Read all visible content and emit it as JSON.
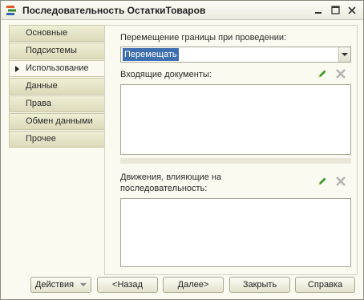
{
  "window": {
    "title": "Последовательность ОстаткиТоваров",
    "app_icon": "sequence-icon",
    "controls": [
      "minimize-icon",
      "maximize-icon",
      "close-icon"
    ]
  },
  "sidebar": {
    "active_index": 2,
    "items": [
      {
        "label": "Основные"
      },
      {
        "label": "Подсистемы"
      },
      {
        "label": "Использование"
      },
      {
        "label": "Данные"
      },
      {
        "label": "Права"
      },
      {
        "label": "Обмен данными"
      },
      {
        "label": "Прочее"
      }
    ]
  },
  "main": {
    "boundary_label": "Перемещение границы при проведении:",
    "boundary_value": "Перемещать",
    "incoming_label": "Входящие  документы:",
    "movements_label_line1": "Движения, влияющие на",
    "movements_label_line2": "последовательность:",
    "edit_icon": "pencil-icon",
    "delete_icon": "delete-x-icon"
  },
  "footer": {
    "actions": "Действия",
    "back": "<Назад",
    "next": "Далее>",
    "close": "Закрыть",
    "help": "Справка"
  },
  "colors": {
    "selection": "#3d6fb0",
    "edit_icon": "#3f9a2b",
    "delete_icon": "#b3b3b3"
  }
}
